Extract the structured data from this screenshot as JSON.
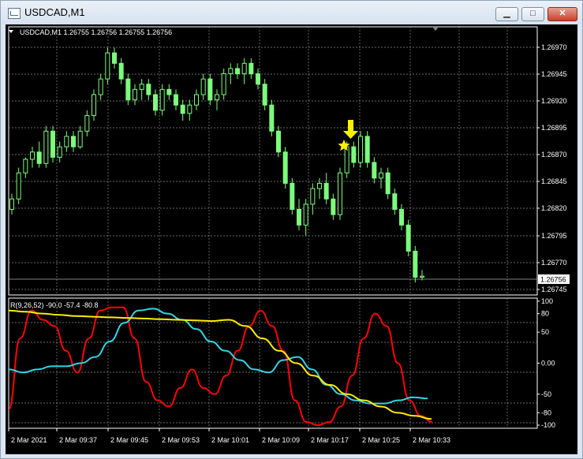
{
  "window": {
    "title": "USDCAD,M1",
    "buttons": {
      "minimize": "▁",
      "maximize": "□",
      "close": "✕"
    }
  },
  "main_header": "USDCAD,M1  1.26755 1.26756 1.26755 1.26756",
  "indicator_header": "R(9,26,52) -90.0 -57.4 -80.8",
  "current_price": "1.26756",
  "colors": {
    "background": "#000000",
    "grid": "#8a8a8a",
    "candle": "#7CFC7C",
    "red_line": "#ff0000",
    "cyan_line": "#33d6e6",
    "yellow_line": "#ffee00",
    "arrow": "#ffee00"
  },
  "chart_data": [
    {
      "type": "candlestick",
      "y_ticks": [
        "1.26970",
        "1.26945",
        "1.26920",
        "1.26895",
        "1.26870",
        "1.26845",
        "1.26820",
        "1.26795",
        "1.26770",
        "1.26745"
      ],
      "ylim": [
        1.26738,
        1.26995
      ],
      "candles": [
        [
          1.2682,
          1.26835,
          1.26815,
          1.2683
        ],
        [
          1.2683,
          1.2686,
          1.26825,
          1.26855
        ],
        [
          1.26855,
          1.2687,
          1.2685,
          1.26868
        ],
        [
          1.26868,
          1.2688,
          1.2686,
          1.26875
        ],
        [
          1.26875,
          1.26885,
          1.2686,
          1.26864
        ],
        [
          1.26864,
          1.269,
          1.2686,
          1.26895
        ],
        [
          1.26895,
          1.269,
          1.26865,
          1.2687
        ],
        [
          1.2687,
          1.26885,
          1.26865,
          1.2688
        ],
        [
          1.2688,
          1.26895,
          1.26875,
          1.2689
        ],
        [
          1.2689,
          1.26895,
          1.26875,
          1.2688
        ],
        [
          1.2688,
          1.269,
          1.26878,
          1.26895
        ],
        [
          1.26895,
          1.26915,
          1.2689,
          1.2691
        ],
        [
          1.2691,
          1.26935,
          1.26905,
          1.2693
        ],
        [
          1.2693,
          1.2695,
          1.26925,
          1.26945
        ],
        [
          1.26945,
          1.26975,
          1.2694,
          1.2697
        ],
        [
          1.2697,
          1.26975,
          1.26955,
          1.2696
        ],
        [
          1.2696,
          1.26965,
          1.2694,
          1.26945
        ],
        [
          1.26945,
          1.2695,
          1.2692,
          1.26925
        ],
        [
          1.26925,
          1.2694,
          1.2692,
          1.26935
        ],
        [
          1.26935,
          1.26945,
          1.26925,
          1.2694
        ],
        [
          1.2694,
          1.26945,
          1.26925,
          1.2693
        ],
        [
          1.2693,
          1.26935,
          1.2691,
          1.26915
        ],
        [
          1.26915,
          1.2694,
          1.2691,
          1.26935
        ],
        [
          1.26935,
          1.2694,
          1.26925,
          1.2693
        ],
        [
          1.2693,
          1.26935,
          1.26915,
          1.2692
        ],
        [
          1.2692,
          1.26925,
          1.26905,
          1.26912
        ],
        [
          1.26912,
          1.26925,
          1.26905,
          1.2692
        ],
        [
          1.2692,
          1.26935,
          1.26915,
          1.2693
        ],
        [
          1.2693,
          1.2695,
          1.26925,
          1.26945
        ],
        [
          1.26945,
          1.2695,
          1.2692,
          1.26925
        ],
        [
          1.26925,
          1.26935,
          1.26915,
          1.2693
        ],
        [
          1.2693,
          1.26955,
          1.26925,
          1.2695
        ],
        [
          1.2695,
          1.2696,
          1.2694,
          1.26955
        ],
        [
          1.26955,
          1.2696,
          1.26945,
          1.2695
        ],
        [
          1.2695,
          1.26965,
          1.2694,
          1.2696
        ],
        [
          1.2696,
          1.26965,
          1.26945,
          1.2695
        ],
        [
          1.2695,
          1.26955,
          1.26935,
          1.2694
        ],
        [
          1.2694,
          1.26945,
          1.26915,
          1.2692
        ],
        [
          1.2692,
          1.26925,
          1.2689,
          1.26895
        ],
        [
          1.26895,
          1.269,
          1.2687,
          1.26875
        ],
        [
          1.26875,
          1.2688,
          1.2684,
          1.26845
        ],
        [
          1.26845,
          1.2685,
          1.26815,
          1.2682
        ],
        [
          1.2682,
          1.2683,
          1.268,
          1.26805
        ],
        [
          1.26805,
          1.2683,
          1.26795,
          1.26825
        ],
        [
          1.26825,
          1.26845,
          1.26815,
          1.2684
        ],
        [
          1.2684,
          1.2685,
          1.2683,
          1.26845
        ],
        [
          1.26845,
          1.26855,
          1.26825,
          1.2683
        ],
        [
          1.2683,
          1.26835,
          1.2681,
          1.26815
        ],
        [
          1.26815,
          1.2686,
          1.2681,
          1.26855
        ],
        [
          1.26855,
          1.26885,
          1.2685,
          1.2688
        ],
        [
          1.2688,
          1.26885,
          1.2686,
          1.26865
        ],
        [
          1.26865,
          1.26895,
          1.2686,
          1.2689
        ],
        [
          1.2689,
          1.26895,
          1.2686,
          1.26865
        ],
        [
          1.26865,
          1.2687,
          1.26845,
          1.2685
        ],
        [
          1.2685,
          1.2686,
          1.2684,
          1.26855
        ],
        [
          1.26855,
          1.2686,
          1.2683,
          1.26835
        ],
        [
          1.26835,
          1.2684,
          1.26815,
          1.2682
        ],
        [
          1.2682,
          1.26825,
          1.268,
          1.26805
        ],
        [
          1.26805,
          1.2681,
          1.26775,
          1.2678
        ],
        [
          1.2678,
          1.26785,
          1.2675,
          1.26755
        ],
        [
          1.26755,
          1.26762,
          1.26752,
          1.26756
        ]
      ]
    },
    {
      "type": "line",
      "y_ticks": [
        "100",
        "80",
        "50",
        "0.00",
        "-50",
        "-80",
        "-100"
      ],
      "y_tick_values": [
        100,
        80,
        50,
        0,
        -50,
        -80,
        -100
      ],
      "ylim": [
        -105,
        105
      ],
      "x_labels": [
        "2 Mar 2021",
        "2 Mar 09:37",
        "2 Mar 09:45",
        "2 Mar 09:53",
        "2 Mar 10:01",
        "2 Mar 10:09",
        "2 Mar 10:17",
        "2 Mar 10:25",
        "2 Mar 10:33"
      ],
      "series": [
        {
          "color": "#ff0000",
          "values": [
            -75,
            40,
            85,
            70,
            60,
            20,
            -15,
            40,
            85,
            90,
            90,
            40,
            -30,
            -60,
            -70,
            -40,
            -10,
            -40,
            -50,
            -20,
            20,
            60,
            85,
            60,
            20,
            -60,
            -95,
            -100,
            -95,
            -70,
            -20,
            40,
            80,
            60,
            0,
            -60,
            -85,
            -95
          ]
        },
        {
          "color": "#33d6e6",
          "values": [
            -10,
            -15,
            -10,
            -5,
            -5,
            0,
            10,
            35,
            65,
            85,
            88,
            80,
            70,
            55,
            35,
            20,
            5,
            -10,
            -15,
            5,
            10,
            -10,
            -35,
            -50,
            -60,
            -65,
            -65,
            -60,
            -55,
            -57
          ]
        },
        {
          "color": "#ffee00",
          "values": [
            85,
            83,
            80,
            78,
            76,
            75,
            74,
            73,
            72,
            71,
            70,
            69,
            68,
            70,
            60,
            40,
            20,
            0,
            -20,
            -35,
            -50,
            -60,
            -70,
            -80,
            -85,
            -90
          ]
        }
      ]
    }
  ]
}
